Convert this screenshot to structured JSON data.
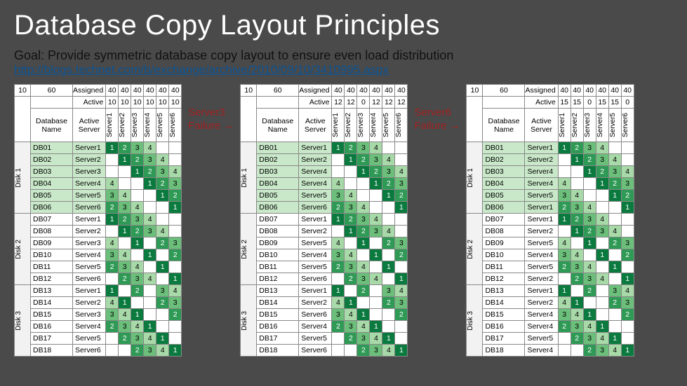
{
  "title": "Database Copy Layout Principles",
  "goal": "Goal: Provide symmetric database copy layout to ensure even load distribution",
  "link": "http://blogs.technet.com/b/exchange/archive/2010/09/10/3410995.aspx",
  "fail1": {
    "a": "Server3",
    "b": "Failure →"
  },
  "fail2": {
    "a": "Server6",
    "b": "Failure →"
  },
  "headers": {
    "corner": [
      "10",
      "60"
    ],
    "assigned": "Assigned",
    "active": "Active",
    "name": "Database Name",
    "server": "Active Server",
    "servers": [
      "Server1",
      "Server2",
      "Server3",
      "Server4",
      "Server5",
      "Server6"
    ],
    "disks": [
      "Disk 1",
      "Disk 2",
      "Disk 3"
    ]
  },
  "panels": [
    {
      "assigned": [
        "40",
        "40",
        "40",
        "40",
        "40",
        "40"
      ],
      "active": [
        "10",
        "10",
        "10",
        "10",
        "10",
        "10"
      ],
      "rows": [
        {
          "db": "DB01",
          "srv": "Server1",
          "c": [
            "1",
            "2",
            "3",
            "4",
            "",
            ""
          ]
        },
        {
          "db": "DB02",
          "srv": "Server2",
          "c": [
            "",
            "1",
            "2",
            "3",
            "4",
            ""
          ]
        },
        {
          "db": "DB03",
          "srv": "Server3",
          "c": [
            "",
            "",
            "1",
            "2",
            "3",
            "4"
          ]
        },
        {
          "db": "DB04",
          "srv": "Server4",
          "c": [
            "4",
            "",
            "",
            "1",
            "2",
            "3"
          ]
        },
        {
          "db": "DB05",
          "srv": "Server5",
          "c": [
            "3",
            "4",
            "",
            "",
            "1",
            "2"
          ]
        },
        {
          "db": "DB06",
          "srv": "Server6",
          "c": [
            "2",
            "3",
            "4",
            "",
            "",
            "1"
          ]
        },
        {
          "db": "DB07",
          "srv": "Server1",
          "c": [
            "1",
            "2",
            "3",
            "4",
            "",
            ""
          ]
        },
        {
          "db": "DB08",
          "srv": "Server2",
          "c": [
            "",
            "1",
            "2",
            "3",
            "4",
            ""
          ]
        },
        {
          "db": "DB09",
          "srv": "Server3",
          "c": [
            "4",
            "",
            "1",
            "",
            "2",
            "3"
          ]
        },
        {
          "db": "DB10",
          "srv": "Server4",
          "c": [
            "3",
            "4",
            "",
            "1",
            "",
            "2"
          ]
        },
        {
          "db": "DB11",
          "srv": "Server5",
          "c": [
            "2",
            "3",
            "4",
            "",
            "1",
            ""
          ]
        },
        {
          "db": "DB12",
          "srv": "Server6",
          "c": [
            "",
            "2",
            "3",
            "4",
            "",
            "1"
          ]
        },
        {
          "db": "DB13",
          "srv": "Server1",
          "c": [
            "1",
            "",
            "2",
            "",
            "3",
            "4"
          ]
        },
        {
          "db": "DB14",
          "srv": "Server2",
          "c": [
            "4",
            "1",
            "",
            "",
            "2",
            "3"
          ]
        },
        {
          "db": "DB15",
          "srv": "Server3",
          "c": [
            "3",
            "4",
            "1",
            "",
            "",
            "2"
          ]
        },
        {
          "db": "DB16",
          "srv": "Server4",
          "c": [
            "2",
            "3",
            "4",
            "1",
            "",
            ""
          ]
        },
        {
          "db": "DB17",
          "srv": "Server5",
          "c": [
            "",
            "2",
            "3",
            "4",
            "1",
            ""
          ]
        },
        {
          "db": "DB18",
          "srv": "Server6",
          "c": [
            "",
            "",
            "2",
            "3",
            "4",
            "1"
          ]
        }
      ]
    },
    {
      "assigned": [
        "40",
        "40",
        "40",
        "40",
        "40",
        "40"
      ],
      "active": [
        "12",
        "12",
        "0",
        "12",
        "12",
        "12"
      ],
      "rows": [
        {
          "db": "DB01",
          "srv": "Server1",
          "c": [
            "1",
            "2",
            "3",
            "4",
            "",
            ""
          ]
        },
        {
          "db": "DB02",
          "srv": "Server2",
          "c": [
            "",
            "1",
            "2",
            "3",
            "4",
            ""
          ]
        },
        {
          "db": "DB03",
          "srv": "Server4",
          "c": [
            "",
            "",
            "1",
            "2",
            "3",
            "4"
          ]
        },
        {
          "db": "DB04",
          "srv": "Server4",
          "c": [
            "4",
            "",
            "",
            "1",
            "2",
            "3"
          ]
        },
        {
          "db": "DB05",
          "srv": "Server5",
          "c": [
            "3",
            "4",
            "",
            "",
            "1",
            "2"
          ]
        },
        {
          "db": "DB06",
          "srv": "Server6",
          "c": [
            "2",
            "3",
            "4",
            "",
            "",
            "1"
          ]
        },
        {
          "db": "DB07",
          "srv": "Server1",
          "c": [
            "1",
            "2",
            "3",
            "4",
            "",
            ""
          ]
        },
        {
          "db": "DB08",
          "srv": "Server2",
          "c": [
            "",
            "1",
            "2",
            "3",
            "4",
            ""
          ]
        },
        {
          "db": "DB09",
          "srv": "Server5",
          "c": [
            "4",
            "",
            "1",
            "",
            "2",
            "3"
          ]
        },
        {
          "db": "DB10",
          "srv": "Server4",
          "c": [
            "3",
            "4",
            "",
            "1",
            "",
            "2"
          ]
        },
        {
          "db": "DB11",
          "srv": "Server5",
          "c": [
            "2",
            "3",
            "4",
            "",
            "1",
            ""
          ]
        },
        {
          "db": "DB12",
          "srv": "Server6",
          "c": [
            "",
            "2",
            "3",
            "4",
            "",
            "1"
          ]
        },
        {
          "db": "DB13",
          "srv": "Server1",
          "c": [
            "1",
            "",
            "2",
            "",
            "3",
            "4"
          ]
        },
        {
          "db": "DB14",
          "srv": "Server2",
          "c": [
            "4",
            "1",
            "",
            "",
            "2",
            "3"
          ]
        },
        {
          "db": "DB15",
          "srv": "Server6",
          "c": [
            "3",
            "4",
            "1",
            "",
            "",
            "2"
          ]
        },
        {
          "db": "DB16",
          "srv": "Server4",
          "c": [
            "2",
            "3",
            "4",
            "1",
            "",
            ""
          ]
        },
        {
          "db": "DB17",
          "srv": "Server5",
          "c": [
            "",
            "2",
            "3",
            "4",
            "1",
            ""
          ]
        },
        {
          "db": "DB18",
          "srv": "Server6",
          "c": [
            "",
            "",
            "2",
            "3",
            "4",
            "1"
          ]
        }
      ]
    },
    {
      "assigned": [
        "40",
        "40",
        "40",
        "40",
        "40",
        "40"
      ],
      "active": [
        "15",
        "15",
        "0",
        "15",
        "15",
        "0"
      ],
      "rows": [
        {
          "db": "DB01",
          "srv": "Server1",
          "c": [
            "1",
            "2",
            "3",
            "4",
            "",
            ""
          ]
        },
        {
          "db": "DB02",
          "srv": "Server2",
          "c": [
            "",
            "1",
            "2",
            "3",
            "4",
            ""
          ]
        },
        {
          "db": "DB03",
          "srv": "Server4",
          "c": [
            "",
            "",
            "1",
            "2",
            "3",
            "4"
          ]
        },
        {
          "db": "DB04",
          "srv": "Server4",
          "c": [
            "4",
            "",
            "",
            "1",
            "2",
            "3"
          ]
        },
        {
          "db": "DB05",
          "srv": "Server5",
          "c": [
            "3",
            "4",
            "",
            "",
            "1",
            "2"
          ]
        },
        {
          "db": "DB06",
          "srv": "Server1",
          "c": [
            "2",
            "3",
            "4",
            "",
            "",
            "1"
          ]
        },
        {
          "db": "DB07",
          "srv": "Server1",
          "c": [
            "1",
            "2",
            "3",
            "4",
            "",
            ""
          ]
        },
        {
          "db": "DB08",
          "srv": "Server2",
          "c": [
            "",
            "1",
            "2",
            "3",
            "4",
            ""
          ]
        },
        {
          "db": "DB09",
          "srv": "Server5",
          "c": [
            "4",
            "",
            "1",
            "",
            "2",
            "3"
          ]
        },
        {
          "db": "DB10",
          "srv": "Server4",
          "c": [
            "3",
            "4",
            "",
            "1",
            "",
            "2"
          ]
        },
        {
          "db": "DB11",
          "srv": "Server5",
          "c": [
            "2",
            "3",
            "4",
            "",
            "1",
            ""
          ]
        },
        {
          "db": "DB12",
          "srv": "Server2",
          "c": [
            "",
            "2",
            "3",
            "4",
            "",
            "1"
          ]
        },
        {
          "db": "DB13",
          "srv": "Server1",
          "c": [
            "1",
            "",
            "2",
            "",
            "3",
            "4"
          ]
        },
        {
          "db": "DB14",
          "srv": "Server2",
          "c": [
            "4",
            "1",
            "",
            "",
            "2",
            "3"
          ]
        },
        {
          "db": "DB15",
          "srv": "Server4",
          "c": [
            "3",
            "4",
            "1",
            "",
            "",
            "2"
          ]
        },
        {
          "db": "DB16",
          "srv": "Server4",
          "c": [
            "2",
            "3",
            "4",
            "1",
            "",
            ""
          ]
        },
        {
          "db": "DB17",
          "srv": "Server5",
          "c": [
            "",
            "2",
            "3",
            "4",
            "1",
            ""
          ]
        },
        {
          "db": "DB18",
          "srv": "Server4",
          "c": [
            "",
            "",
            "2",
            "3",
            "4",
            "1"
          ]
        }
      ]
    }
  ]
}
